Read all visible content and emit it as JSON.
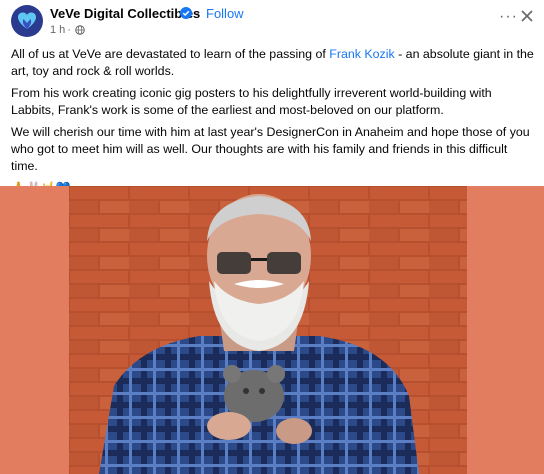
{
  "post": {
    "page_name": "VeVe Digital Collectibles",
    "follow_label": "Follow",
    "timestamp": "1 h",
    "more_label": "···",
    "paragraphs": {
      "p1_before": "All of us at VeVe are devastated to learn of the passing of ",
      "p1_link": "Frank Kozik",
      "p1_after": " - an absolute giant in the art, toy and rock & roll worlds.",
      "p2": "From his work creating iconic gig posters to his delightfully irreverent world-building with Labbits, Frank's work is some of the earliest and most-beloved on our platform.",
      "p3": "We will cherish our time with him at last year's DesignerCon in Anaheim and hope those of you who got to meet him will as well. Our thoughts are with his family and friends in this difficult time."
    },
    "emojis": "🙏🐰🤘💙"
  },
  "colors": {
    "link": "#1877f2",
    "photo_background": "#e27d60",
    "secondary_text": "#65676b"
  }
}
